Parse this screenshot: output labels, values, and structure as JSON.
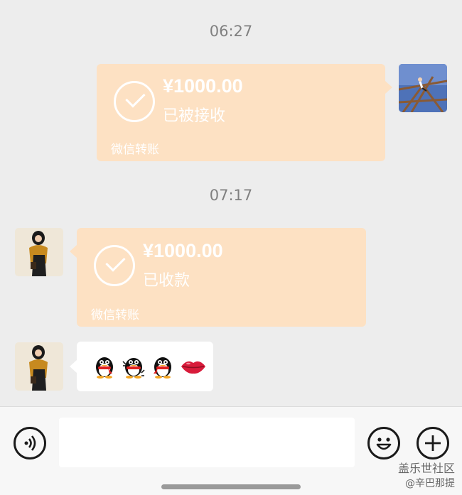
{
  "chat": {
    "timestamps": [
      "06:27",
      "07:17"
    ],
    "messages": [
      {
        "type": "transfer",
        "sender": "me",
        "amount": "¥1000.00",
        "status": "已被接收",
        "footer": "微信转账"
      },
      {
        "type": "transfer",
        "sender": "other",
        "amount": "¥1000.00",
        "status": "已收款",
        "footer": "微信转账"
      },
      {
        "type": "emoji",
        "sender": "other",
        "emojis": [
          "qq-penguin-icon",
          "qq-penguin-dance-icon",
          "qq-penguin-icon",
          "lips-icon"
        ]
      }
    ]
  },
  "input_bar": {
    "voice_icon": "voice-icon",
    "text_value": "",
    "emoji_icon": "smiley-icon",
    "more_icon": "plus-icon"
  },
  "watermark": {
    "main": "盖乐世社区",
    "sub": "@辛巴那提"
  },
  "colors": {
    "transfer_bubble": "#fde1c3",
    "background": "#ededed",
    "text_bubble": "#ffffff"
  }
}
